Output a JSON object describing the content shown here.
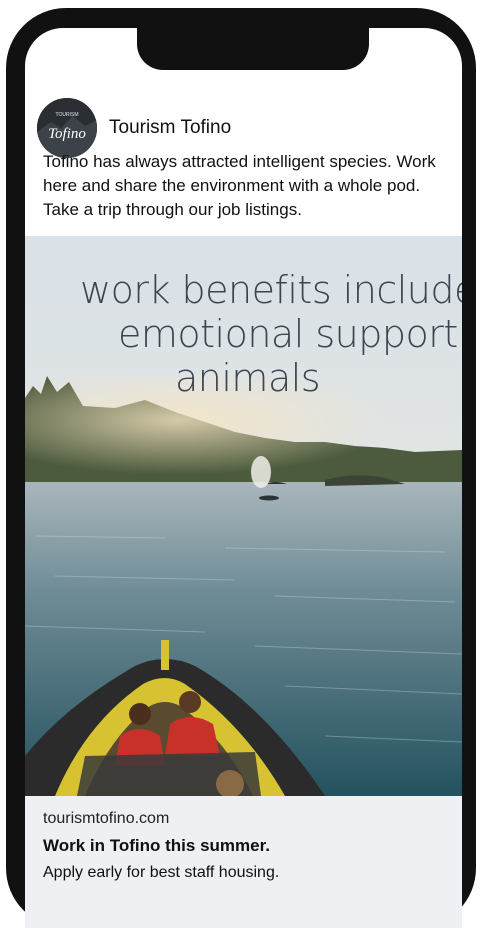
{
  "post": {
    "account_name": "Tourism Tofino",
    "avatar_text": "Tofino",
    "avatar_small_text": "TOURISM",
    "caption": "Tofino has always attracted intelligent species. Work here and share the environment with a whole pod. Take a trip through our job listings."
  },
  "ad": {
    "overlay_lines": [
      "work benefits include:",
      "emotional support",
      "animals"
    ]
  },
  "link": {
    "domain": "tourismtofino.com",
    "headline": "Work in Tofino this summer.",
    "description": "Apply early for best staff housing."
  }
}
